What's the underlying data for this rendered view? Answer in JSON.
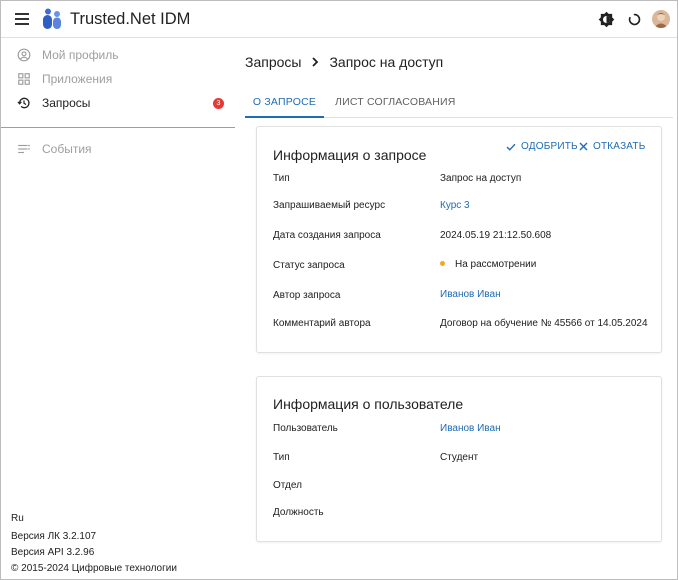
{
  "header": {
    "app_title": "Trusted.Net IDM",
    "icons": [
      "menu-icon",
      "logo-icon",
      "theme-icon",
      "refresh-icon",
      "avatar"
    ],
    "accent": "#1f6bb5"
  },
  "sidebar": {
    "items": [
      {
        "label": "Мой профиль",
        "icon": "account-circle-icon",
        "state": "disabled"
      },
      {
        "label": "Приложения",
        "icon": "apps-icon",
        "state": "disabled"
      },
      {
        "label": "Запросы",
        "icon": "history-icon",
        "state": "active",
        "badge": "3"
      },
      {
        "label": "События",
        "icon": "list-icon",
        "state": "disabled"
      }
    ],
    "footer": {
      "lang": "Ru",
      "version_lk": "Версия ЛК 3.2.107",
      "version_api": "Версия API 3.2.96",
      "copyright": "© 2015-2024 Цифровые технологии"
    }
  },
  "breadcrumb": {
    "parent": "Запросы",
    "separator": "›",
    "current": "Запрос на доступ"
  },
  "tabs": [
    {
      "label": "О ЗАПРОСЕ",
      "active": true
    },
    {
      "label": "ЛИСТ СОГЛАСОВАНИЯ",
      "active": false
    }
  ],
  "request_card": {
    "title": "Информация о запросе",
    "approve_label": "ОДОБРИТЬ",
    "reject_label": "ОТКАЗАТЬ",
    "rows": [
      {
        "label": "Тип",
        "value": "Запрос на доступ"
      },
      {
        "label": "Запрашиваемый ресурс",
        "value": "Курс 3"
      },
      {
        "label": "Дата создания запроса",
        "value": "2024.05.19 21:12.50.608"
      },
      {
        "label": "Статус запроса",
        "value": "На рассмотрении"
      },
      {
        "label": "Автор запроса",
        "value": "Иванов Иван"
      },
      {
        "label": "Комментарий автора",
        "value": "Договор на обучение № 45566 от 14.05.2024"
      }
    ],
    "status_color": "#f5a623"
  },
  "user_card": {
    "title": "Информация о пользователе",
    "rows": [
      {
        "label": "Пользователь",
        "value": "Иванов Иван"
      },
      {
        "label": "Тип",
        "value": "Студент"
      },
      {
        "label": "Отдел",
        "value": ""
      },
      {
        "label": "Должность",
        "value": ""
      }
    ]
  }
}
